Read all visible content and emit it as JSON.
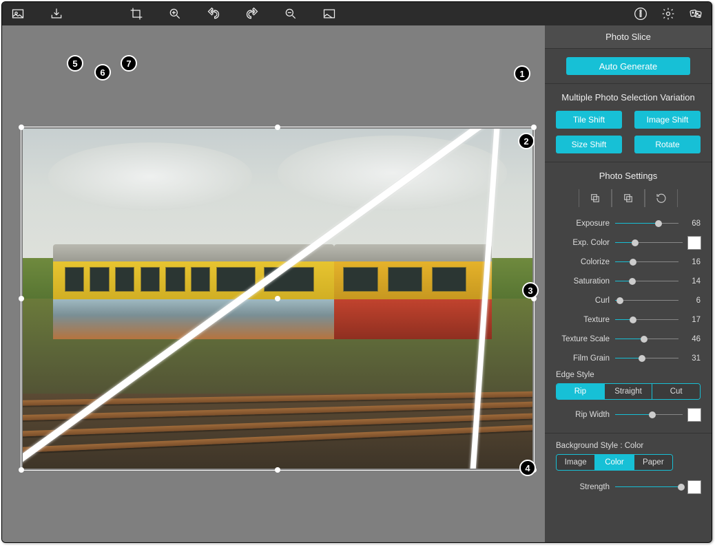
{
  "sidebar": {
    "title": "Photo Slice",
    "autoGenerate": "Auto Generate",
    "variationHeader": "Multiple Photo Selection Variation",
    "variationButtons": {
      "tileShift": "Tile Shift",
      "imageShift": "Image Shift",
      "sizeShift": "Size Shift",
      "rotate": "Rotate"
    },
    "photoSettingsHeader": "Photo Settings",
    "sliders": {
      "exposure": {
        "label": "Exposure",
        "value": 68
      },
      "expColor": {
        "label": "Exp. Color"
      },
      "colorize": {
        "label": "Colorize",
        "value": 16
      },
      "saturation": {
        "label": "Saturation",
        "value": 14
      },
      "curl": {
        "label": "Curl",
        "value": 6
      },
      "texture": {
        "label": "Texture",
        "value": 17
      },
      "textureScale": {
        "label": "Texture Scale",
        "value": 46
      },
      "filmGrain": {
        "label": "Film Grain",
        "value": 31
      },
      "ripWidth": {
        "label": "Rip Width"
      },
      "strength": {
        "label": "Strength"
      }
    },
    "edgeStyle": {
      "label": "Edge Style",
      "options": {
        "rip": "Rip",
        "straight": "Straight",
        "cut": "Cut"
      },
      "active": "rip"
    },
    "backgroundStyle": {
      "label": "Background Style : Color",
      "options": {
        "image": "Image",
        "color": "Color",
        "paper": "Paper"
      },
      "active": "color"
    },
    "expColorSwatch": "#ffffff",
    "ripWidthSwatch": "#ffffff",
    "strengthSwatch": "#ffffff"
  },
  "sliderPositions": {
    "exposure": 68,
    "expColor": 30,
    "colorize": 28,
    "saturation": 27,
    "curl": 8,
    "texture": 28,
    "textureScale": 46,
    "filmGrain": 42,
    "ripWidth": 55,
    "strength": 98
  },
  "annotations": {
    "b1": "1",
    "b2": "2",
    "b3": "3",
    "b4": "4",
    "b5": "5",
    "b6": "6",
    "b7": "7"
  }
}
